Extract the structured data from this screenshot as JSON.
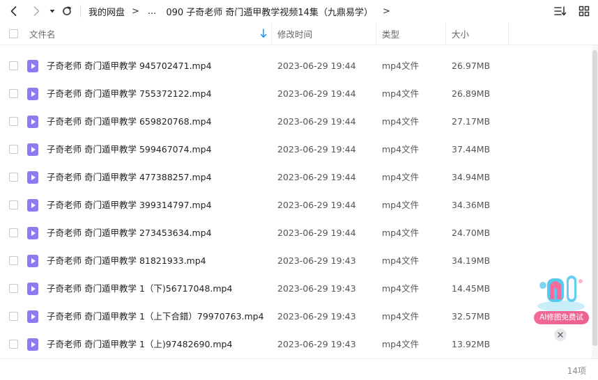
{
  "breadcrumb": {
    "root": "我的网盘",
    "ellipsis": "...",
    "current": "090 子奇老师 奇门遁甲教学视频14集（九鼎易学）"
  },
  "columns": {
    "name": "文件名",
    "modified": "修改时间",
    "type": "类型",
    "size": "大小"
  },
  "files": [
    {
      "name": "子奇老师 奇门遁甲教学 945702471.mp4",
      "modified": "2023-06-29 19:44",
      "type": "mp4文件",
      "size": "26.97MB"
    },
    {
      "name": "子奇老师 奇门遁甲教学 755372122.mp4",
      "modified": "2023-06-29 19:44",
      "type": "mp4文件",
      "size": "26.89MB"
    },
    {
      "name": "子奇老师 奇门遁甲教学 659820768.mp4",
      "modified": "2023-06-29 19:44",
      "type": "mp4文件",
      "size": "27.17MB"
    },
    {
      "name": "子奇老师 奇门遁甲教学 599467074.mp4",
      "modified": "2023-06-29 19:44",
      "type": "mp4文件",
      "size": "37.44MB"
    },
    {
      "name": "子奇老师 奇门遁甲教学 477388257.mp4",
      "modified": "2023-06-29 19:44",
      "type": "mp4文件",
      "size": "34.94MB"
    },
    {
      "name": "子奇老师 奇门遁甲教学 399314797.mp4",
      "modified": "2023-06-29 19:44",
      "type": "mp4文件",
      "size": "34.36MB"
    },
    {
      "name": "子奇老师 奇门遁甲教学 273453634.mp4",
      "modified": "2023-06-29 19:44",
      "type": "mp4文件",
      "size": "24.70MB"
    },
    {
      "name": "子奇老师 奇门遁甲教学 81821933.mp4",
      "modified": "2023-06-29 19:43",
      "type": "mp4文件",
      "size": "34.19MB"
    },
    {
      "name": "子奇老师 奇门遁甲教学 1（下)56717048.mp4",
      "modified": "2023-06-29 19:43",
      "type": "mp4文件",
      "size": "14.45MB"
    },
    {
      "name": "子奇老师 奇门遁甲教学 1（上下合錯）79970763.mp4",
      "modified": "2023-06-29 19:43",
      "type": "mp4文件",
      "size": "32.57MB"
    },
    {
      "name": "子奇老师 奇门遁甲教学 1（上)97482690.mp4",
      "modified": "2023-06-29 19:43",
      "type": "mp4文件",
      "size": "13.92MB"
    }
  ],
  "footer": {
    "count": "14项"
  },
  "ai_promo": {
    "label": "AI修图免费试"
  },
  "colors": {
    "file_icon": "#8a7cf0",
    "sort_arrow": "#1e96f0",
    "promo_pink": "#f06b9b"
  },
  "icons": {
    "back": "chevron-left-icon",
    "forward": "chevron-right-icon",
    "history": "caret-down-icon",
    "refresh": "refresh-icon",
    "sort": "sort-list-icon",
    "grid": "grid-view-icon",
    "file": "video-file-icon"
  }
}
